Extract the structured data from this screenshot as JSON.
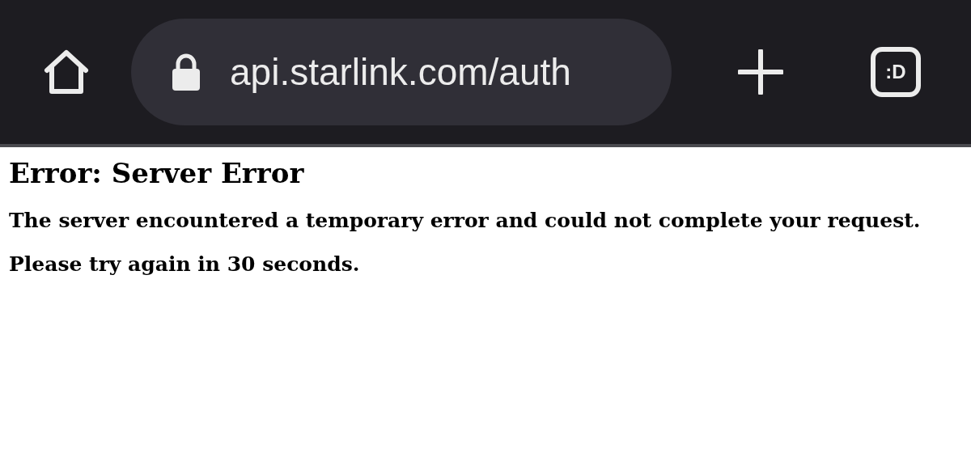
{
  "toolbar": {
    "address": "api.starlink.com/auth",
    "tabs_button": ":D"
  },
  "page": {
    "heading": "Error: Server Error",
    "paragraphs": [
      "The server encountered a temporary error and could not complete your request.",
      "Please try again in 30 seconds."
    ]
  }
}
